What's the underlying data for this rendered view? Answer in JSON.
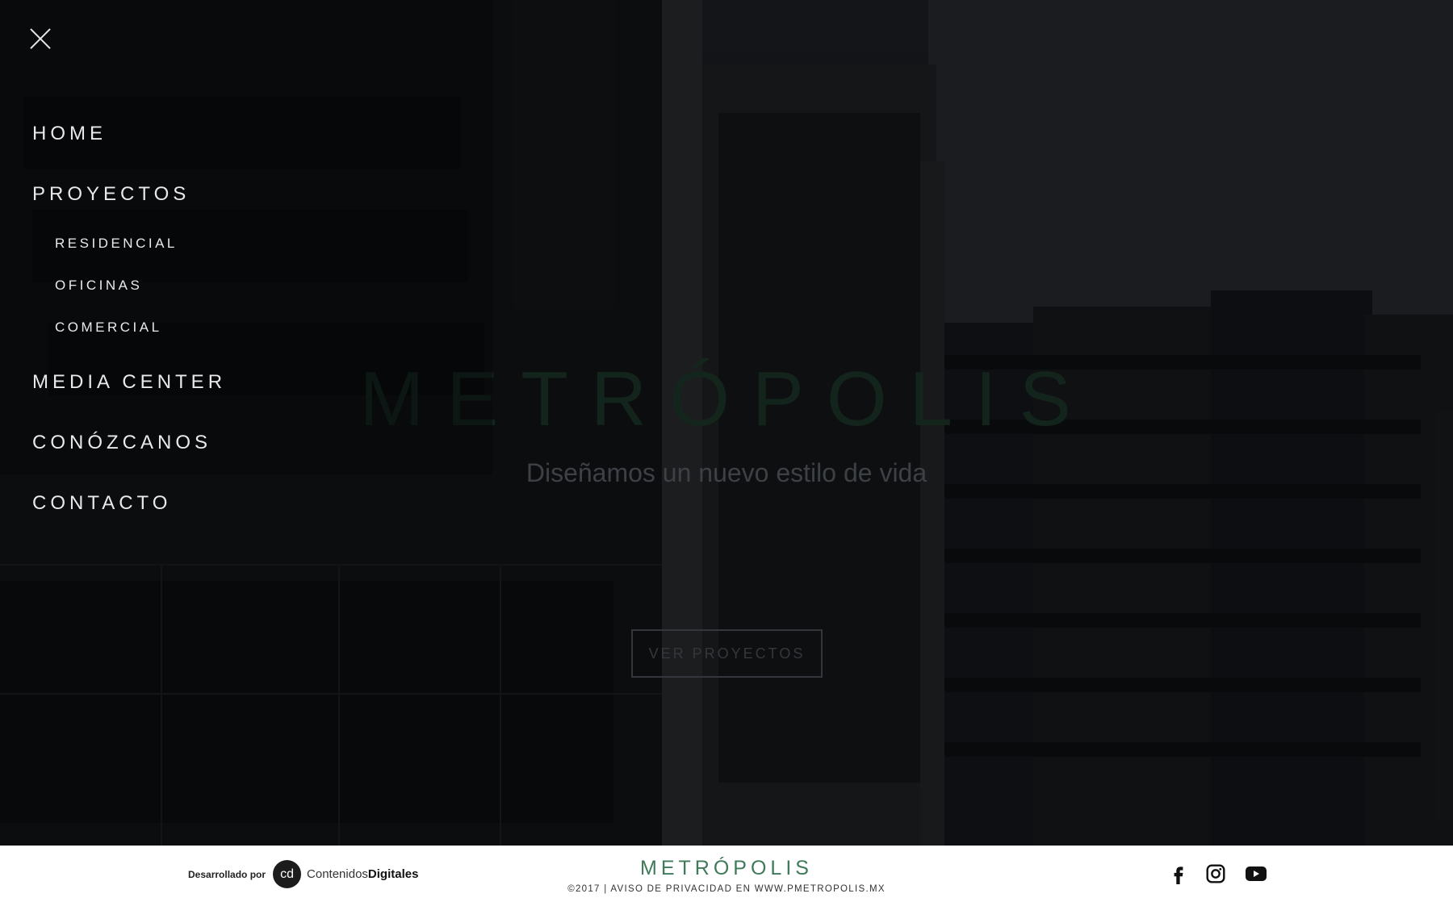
{
  "menu": {
    "close_label": "Cerrar",
    "items": [
      {
        "label": "HOME"
      },
      {
        "label": "PROYECTOS"
      },
      {
        "label": "MEDIA CENTER"
      },
      {
        "label": "CONÓZCANOS"
      },
      {
        "label": "CONTACTO"
      }
    ],
    "sub_items": [
      {
        "label": "RESIDENCIAL"
      },
      {
        "label": "OFICINAS"
      },
      {
        "label": "COMERCIAL"
      }
    ]
  },
  "hero": {
    "title": "METRÓPOLIS",
    "tagline": "Diseñamos un nuevo estilo de vida",
    "button_label": "VER PROYECTOS"
  },
  "footer": {
    "developed_by": "Desarrollado por",
    "dev_logo_mark": "cd",
    "dev_name_light": "Contenidos",
    "dev_name_bold": "Digitales",
    "brand": "METRÓPOLIS",
    "copyright": "©2017 | AVISO DE PRIVACIDAD EN WWW.PMETROPOLIS.MX",
    "social_icons": [
      "facebook-icon",
      "instagram-icon",
      "youtube-icon"
    ]
  },
  "colors": {
    "brand_green": "#3f7a5a",
    "menu_text": "#e9e9e9",
    "footer_bg": "#ffffff"
  }
}
